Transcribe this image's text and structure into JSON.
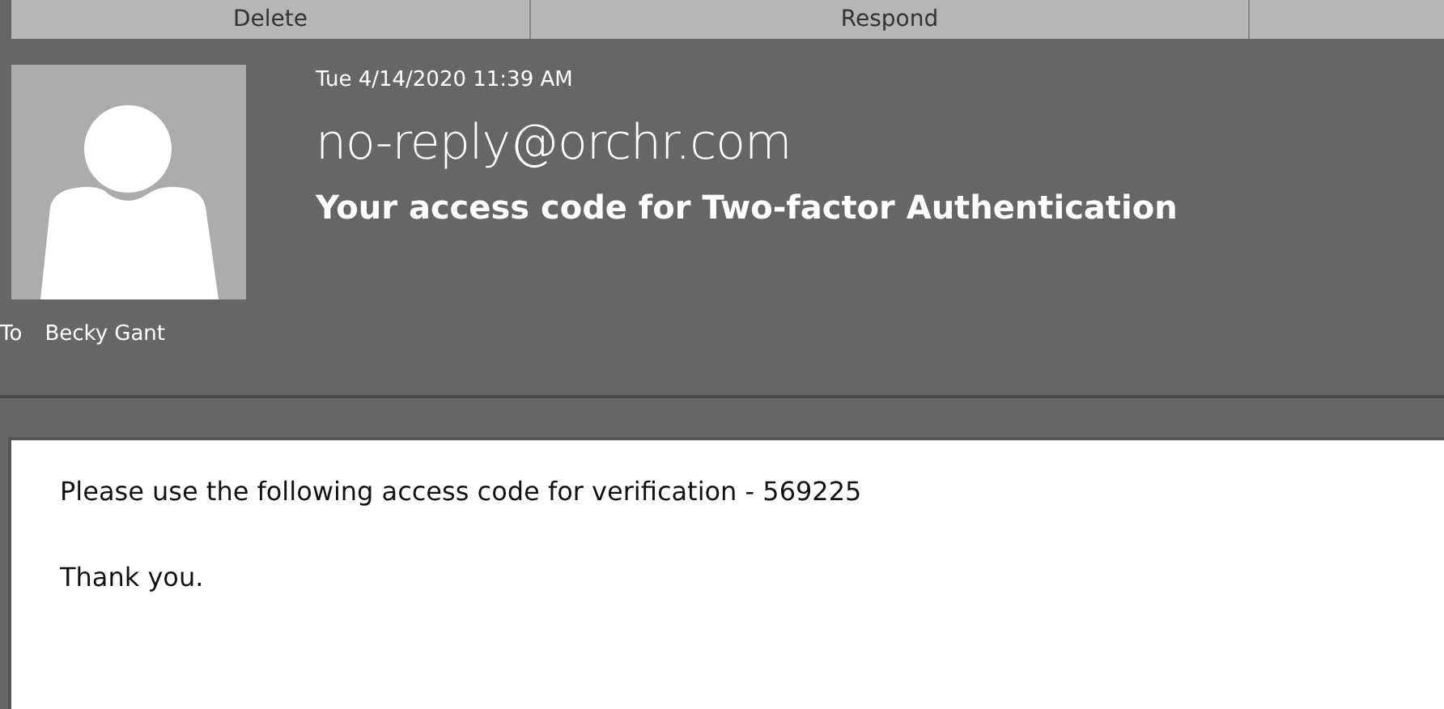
{
  "ribbon": {
    "groups": [
      "Delete",
      "Respond"
    ]
  },
  "message": {
    "date": "Tue 4/14/2020 11:39 AM",
    "sender": "no-reply@orchr.com",
    "subject": "Your access code for Two-factor Authentication",
    "to_label": "To",
    "to": "Becky Gant"
  },
  "body": {
    "paragraphs": [
      "Please use the following access code for verification - 569225",
      "Thank you."
    ]
  }
}
